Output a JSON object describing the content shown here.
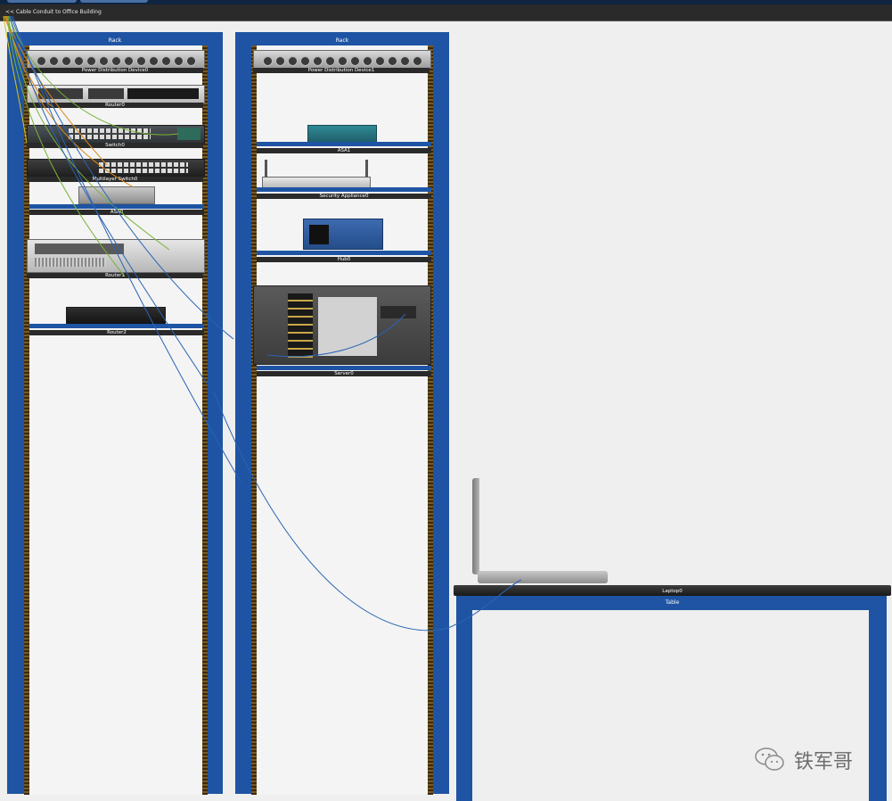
{
  "toolbar": {
    "conduit_link": "<< Cable Conduit to Office Building"
  },
  "racks": [
    {
      "title": "Rack"
    },
    {
      "title": "Rack"
    }
  ],
  "devices": {
    "pdu0": "Power Distribution Device0",
    "router0": "Router0",
    "switch0": "Switch0",
    "mlswitch0": "Multilayer Switch0",
    "asa0": "ASA0",
    "router1": "Router1",
    "router2": "Router2",
    "pdu1": "Power Distribution Device1",
    "asa1": "ASA1",
    "secapp0": "Security Appliance0",
    "hub0": "Hub0",
    "server0": "Server0",
    "laptop0": "Laptop0"
  },
  "table": {
    "title": "Table"
  },
  "watermark": {
    "text": "铁军哥"
  },
  "colors": {
    "rack_blue": "#1e54a3",
    "cable_blue": "#2a64b4",
    "cable_orange": "#d98b1a",
    "cable_green": "#7ab23a",
    "cable_yellow": "#d6c21e"
  }
}
